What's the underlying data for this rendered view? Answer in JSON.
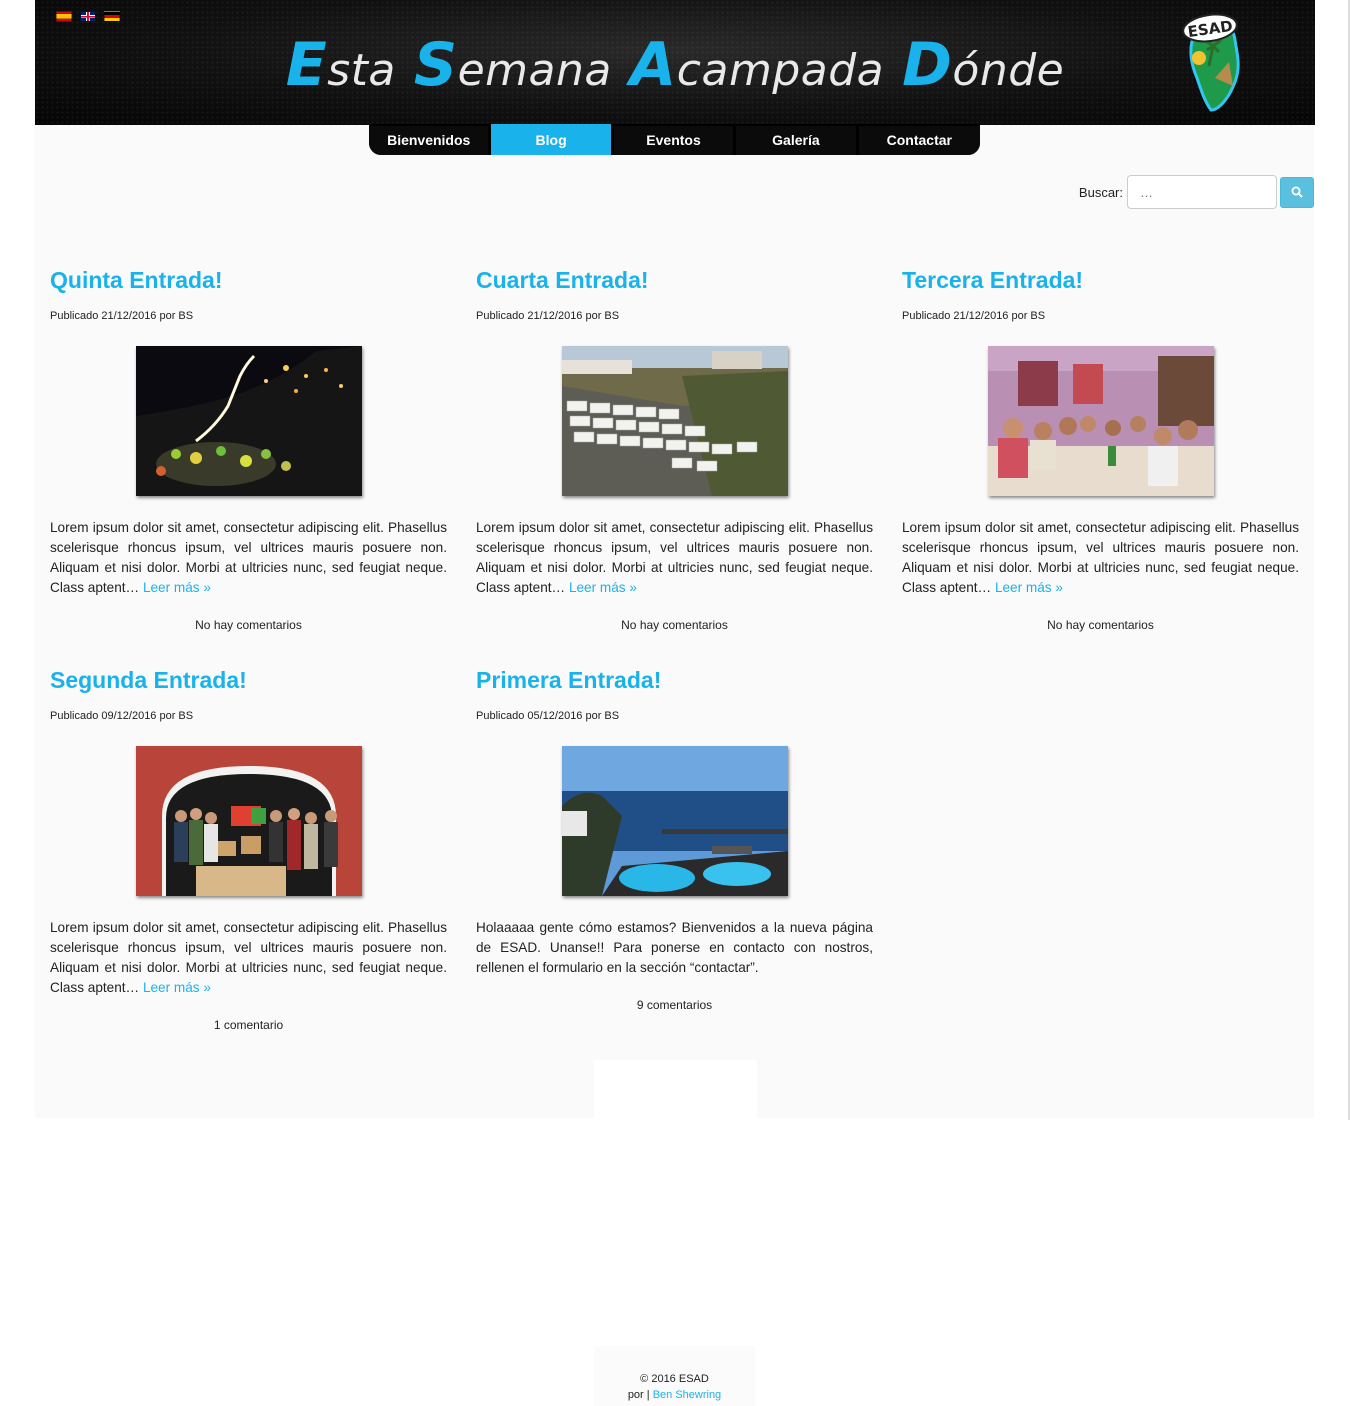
{
  "header": {
    "flags": [
      {
        "name": "spanish-flag-icon",
        "lang": "es"
      },
      {
        "name": "english-flag-icon",
        "lang": "en"
      },
      {
        "name": "german-flag-icon",
        "lang": "de"
      }
    ],
    "title_words": [
      {
        "cap": "E",
        "rest": "sta"
      },
      {
        "cap": "S",
        "rest": "emana"
      },
      {
        "cap": "A",
        "rest": "campada"
      },
      {
        "cap": "D",
        "rest": "ónde"
      }
    ],
    "logo_text": "ESAD"
  },
  "nav": {
    "items": [
      {
        "label": "Bienvenidos",
        "active": false
      },
      {
        "label": "Blog",
        "active": true
      },
      {
        "label": "Eventos",
        "active": false
      },
      {
        "label": "Galería",
        "active": false
      },
      {
        "label": "Contactar",
        "active": false
      }
    ]
  },
  "search": {
    "label": "Buscar:",
    "placeholder": "…",
    "button_icon": "search-icon"
  },
  "posts": [
    {
      "title": "Quinta Entrada!",
      "meta": "Publicado 21/12/2016 por BS",
      "image": "night-procession-photo",
      "excerpt": "Lorem ipsum dolor sit amet, consectetur adipiscing elit. Phasellus scelerisque rhoncus ipsum, vel ultrices mauris posuere non. Aliquam et nisi dolor. Morbi at ultricies nunc, sed feugiat neque. Class aptent…",
      "more": "Leer más »",
      "comments": "No hay comentarios"
    },
    {
      "title": "Cuarta Entrada!",
      "meta": "Publicado 21/12/2016 por BS",
      "image": "caravans-parking-photo",
      "excerpt": "Lorem ipsum dolor sit amet, consectetur adipiscing elit. Phasellus scelerisque rhoncus ipsum, vel ultrices mauris posuere non. Aliquam et nisi dolor. Morbi at ultricies nunc, sed feugiat neque. Class aptent…",
      "more": "Leer más »",
      "comments": "No hay comentarios"
    },
    {
      "title": "Tercera Entrada!",
      "meta": "Publicado 21/12/2016 por BS",
      "image": "group-dinner-photo",
      "excerpt": "Lorem ipsum dolor sit amet, consectetur adipiscing elit. Phasellus scelerisque rhoncus ipsum, vel ultrices mauris posuere non. Aliquam et nisi dolor. Morbi at ultricies nunc, sed feugiat neque. Class aptent…",
      "more": "Leer más »",
      "comments": "No hay comentarios"
    },
    {
      "title": "Segunda Entrada!",
      "meta": "Publicado 09/12/2016 por BS",
      "image": "group-donation-photo",
      "excerpt": "Lorem ipsum dolor sit amet, consectetur adipiscing elit. Phasellus scelerisque rhoncus ipsum, vel ultrices mauris posuere non. Aliquam et nisi dolor. Morbi at ultricies nunc, sed feugiat neque. Class aptent…",
      "more": "Leer más »",
      "comments": "1 comentario"
    },
    {
      "title": "Primera Entrada!",
      "meta": "Publicado 05/12/2016 por BS",
      "image": "sea-pools-photo",
      "excerpt": "Holaaaaa gente cómo estamos? Bienvenidos a la nueva página de ESAD. Unanse!! Para ponerse en contacto con nostros, rellenen el formulario en la sección “contactar”.",
      "more": "",
      "comments": "9 comentarios"
    }
  ],
  "footer": {
    "copyright": "© 2016 ESAD",
    "by_label": "por |",
    "author": "Ben Shewring"
  },
  "colors": {
    "accent": "#1ab2ea",
    "header_bg": "#111111",
    "content_bg": "#fafafa"
  }
}
